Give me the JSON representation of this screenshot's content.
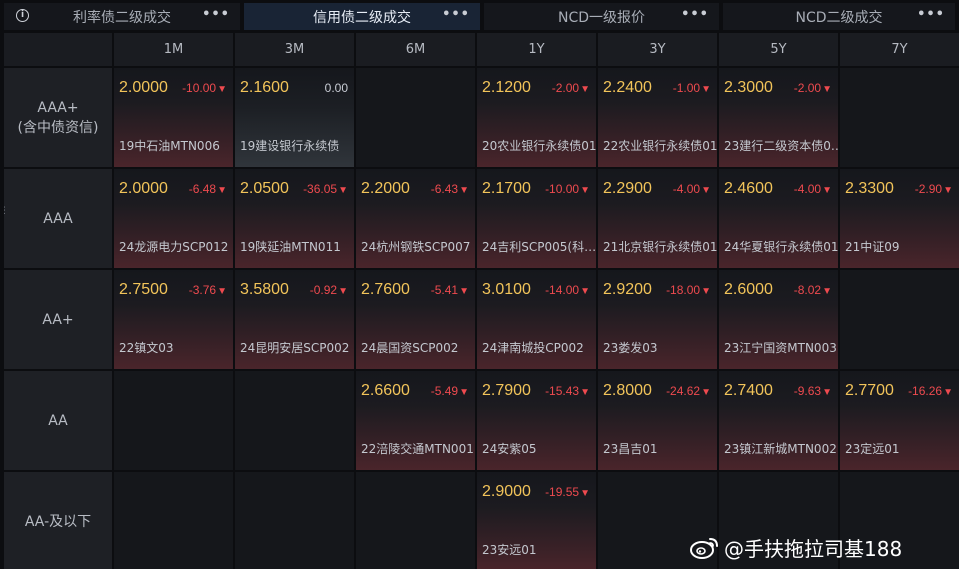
{
  "tabs": [
    {
      "label": "利率债二级成交",
      "active": false,
      "info": true
    },
    {
      "label": "信用债二级成交",
      "active": true,
      "info": false
    },
    {
      "label": "NCD一级报价",
      "active": false,
      "info": false
    },
    {
      "label": "NCD二级成交",
      "active": false,
      "info": false
    }
  ],
  "more_glyph": "•••",
  "columns": [
    "1M",
    "3M",
    "6M",
    "1Y",
    "3Y",
    "5Y",
    "7Y"
  ],
  "rows": [
    {
      "label": [
        "AAA+",
        "(含中债资信)"
      ],
      "cells": [
        {
          "price": "2.0000",
          "change": "-10.00",
          "dir": "down",
          "bond": "19中石油MTN006"
        },
        {
          "price": "2.1600",
          "change": "0.00",
          "dir": "flat",
          "bond": "19建设银行永续债"
        },
        null,
        {
          "price": "2.1200",
          "change": "-2.00",
          "dir": "down",
          "bond": "20农业银行永续债01"
        },
        {
          "price": "2.2400",
          "change": "-1.00",
          "dir": "down",
          "bond": "22农业银行永续债01"
        },
        {
          "price": "2.3000",
          "change": "-2.00",
          "dir": "down",
          "bond": "23建行二级资本债0…"
        },
        null
      ]
    },
    {
      "label": [
        "AAA"
      ],
      "cells": [
        {
          "price": "2.0000",
          "change": "-6.48",
          "dir": "down",
          "bond": "24龙源电力SCP012"
        },
        {
          "price": "2.0500",
          "change": "-36.05",
          "dir": "down",
          "bond": "19陕延油MTN011"
        },
        {
          "price": "2.2000",
          "change": "-6.43",
          "dir": "down",
          "bond": "24杭州钢铁SCP007"
        },
        {
          "price": "2.1700",
          "change": "-10.00",
          "dir": "down",
          "bond": "24吉利SCP005(科…"
        },
        {
          "price": "2.2900",
          "change": "-4.00",
          "dir": "down",
          "bond": "21北京银行永续债01"
        },
        {
          "price": "2.4600",
          "change": "-4.00",
          "dir": "down",
          "bond": "24华夏银行永续债01"
        },
        {
          "price": "2.3300",
          "change": "-2.90",
          "dir": "down",
          "bond": "21中证09"
        }
      ]
    },
    {
      "label": [
        "AA+"
      ],
      "cells": [
        {
          "price": "2.7500",
          "change": "-3.76",
          "dir": "down",
          "bond": "22镇文03"
        },
        {
          "price": "3.5800",
          "change": "-0.92",
          "dir": "down",
          "bond": "24昆明安居SCP002"
        },
        {
          "price": "2.7600",
          "change": "-5.41",
          "dir": "down",
          "bond": "24晨国资SCP002"
        },
        {
          "price": "3.0100",
          "change": "-14.00",
          "dir": "down",
          "bond": "24津南城投CP002"
        },
        {
          "price": "2.9200",
          "change": "-18.00",
          "dir": "down",
          "bond": "23娄发03"
        },
        {
          "price": "2.6000",
          "change": "-8.02",
          "dir": "down",
          "bond": "23江宁国资MTN003"
        },
        null
      ]
    },
    {
      "label": [
        "AA"
      ],
      "cells": [
        null,
        null,
        {
          "price": "2.6600",
          "change": "-5.49",
          "dir": "down",
          "bond": "22涪陵交通MTN001"
        },
        {
          "price": "2.7900",
          "change": "-15.43",
          "dir": "down",
          "bond": "24安紫05"
        },
        {
          "price": "2.8000",
          "change": "-24.62",
          "dir": "down",
          "bond": "23昌吉01"
        },
        {
          "price": "2.7400",
          "change": "-9.63",
          "dir": "down",
          "bond": "23镇江新城MTN002"
        },
        {
          "price": "2.7700",
          "change": "-16.26",
          "dir": "down",
          "bond": "23定远01"
        }
      ]
    },
    {
      "label": [
        "AA-及以下"
      ],
      "cells": [
        null,
        null,
        null,
        {
          "price": "2.9000",
          "change": "-19.55",
          "dir": "down",
          "bond": "23安远01"
        },
        null,
        null,
        null
      ]
    }
  ],
  "down_arrow": "▼",
  "watermark": "@手扶拖拉司基188",
  "watermark_icon": "weibo-icon"
}
